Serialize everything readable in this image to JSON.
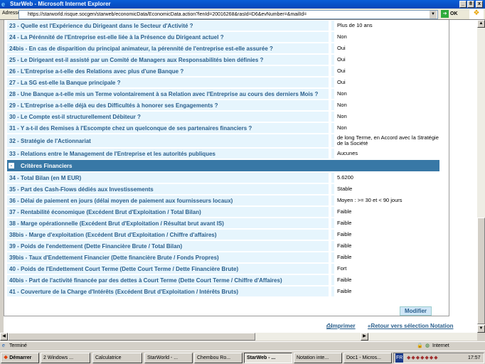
{
  "window": {
    "title": "StarWeb - Microsoft Internet Explorer",
    "min": "_",
    "max": "8",
    "close": "x"
  },
  "address": {
    "label": "Adresse",
    "url": "https://starworld.risque.socgen/starweb/economicData/EconomicData.action?lenId=20016268&rasId=D6&evNumber=&mailId=",
    "go": "OK"
  },
  "questions": [
    {
      "q": "23 - Quelle est l'Expérience du Dirigeant dans le Secteur d'Activité ?",
      "a": "Plus de 10 ans"
    },
    {
      "q": "24 - La Pérénnité de l'Entreprise est-elle liée à la Présence du Dirigeant actuel ?",
      "a": "Non"
    },
    {
      "q": "24bis - En cas de disparition du principal animateur, la pérennité de l'entreprise est-elle assurée ?",
      "a": "Oui"
    },
    {
      "q": "25 - Le Dirigeant est-il assisté par un Comité de Managers aux Responsabilités bien définies ?",
      "a": "Oui"
    },
    {
      "q": "26 - L'Entreprise a-t-elle des Relations avec plus d'une Banque ?",
      "a": "Oui"
    },
    {
      "q": "27 - La SG est-elle la Banque principale ?",
      "a": "Oui"
    },
    {
      "q": "28 - Une Banque a-t-elle mis un Terme volontairement à sa Relation avec l'Entreprise au cours des derniers Mois ?",
      "a": "Non"
    },
    {
      "q": "29 - L'Entreprise a-t-elle déjà eu des Difficultés à honorer ses Engagements ?",
      "a": "Non"
    },
    {
      "q": "30 - Le Compte est-il structurellement Débiteur ?",
      "a": "Non"
    },
    {
      "q": "31 - Y a-t-il des Remises à l'Escompte chez un quelconque de ses partenaires financiers ?",
      "a": "Non"
    },
    {
      "q": "32 - Stratégie de l'Actionnariat",
      "a": "de long Terme, en Accord avec la Stratégie de la Société"
    },
    {
      "q": "33 - Relations entre le Management de l'Entreprise et les autorités publiques",
      "a": "Aucunes"
    }
  ],
  "section": {
    "toggle": "-",
    "title": "Critères Financiers"
  },
  "financial": [
    {
      "q": "34 - Total Bilan (en M EUR)",
      "a": "5.6200"
    },
    {
      "q": "35 - Part des Cash-Flows dédiés aux Investissements",
      "a": "Stable"
    },
    {
      "q": "36 - Délai de paiement en jours (délai moyen de paiement aux fournisseurs locaux)",
      "a": "Moyen : >= 30 et < 90 jours"
    },
    {
      "q": "37 - Rentabilité économique (Excédent Brut d'Exploitation / Total Bilan)",
      "a": "Faible"
    },
    {
      "q": "38 - Marge opérationnelle (Excédent Brut d'Exploitation / Résultat brut avant IS)",
      "a": "Faible"
    },
    {
      "q": "38bis - Marge d'exploitation (Excédent Brut d'Exploitation / Chiffre d'affaires)",
      "a": "Faible"
    },
    {
      "q": "39 - Poids de l'endettement (Dette Financière Brute / Total Bilan)",
      "a": "Faible"
    },
    {
      "q": "39bis - Taux d'Endettement Financier (Dette financière Brute / Fonds Propres)",
      "a": "Faible"
    },
    {
      "q": "40 - Poids de l'Endettement Court Terme (Dette Court Terme / Dette Financière Brute)",
      "a": "Fort"
    },
    {
      "q": "40bis - Part de l'activité financée par des dettes à Court Terme (Dette Court Terme / Chiffre d'Affaires)",
      "a": "Faible"
    },
    {
      "q": "41 - Couverture de la Charge d'Intérêts (Excédent Brut d'Exploitation / Intérêts Bruts)",
      "a": "Faible"
    }
  ],
  "buttons": {
    "modifier": "Modifier",
    "print": "Imprimer",
    "back": "Retour vers sélection Notation"
  },
  "status": {
    "text": "Terminé",
    "zone": "Internet"
  },
  "taskbar": {
    "start": "Démarrer",
    "items": [
      "2 Windows ...",
      "Calculatrice",
      "StarWorld - ...",
      "Chembou Ro...",
      "StarWeb - ...",
      "Notation inte...",
      "Doc1 - Micros..."
    ],
    "lang": "FR",
    "clock": "17:57"
  }
}
